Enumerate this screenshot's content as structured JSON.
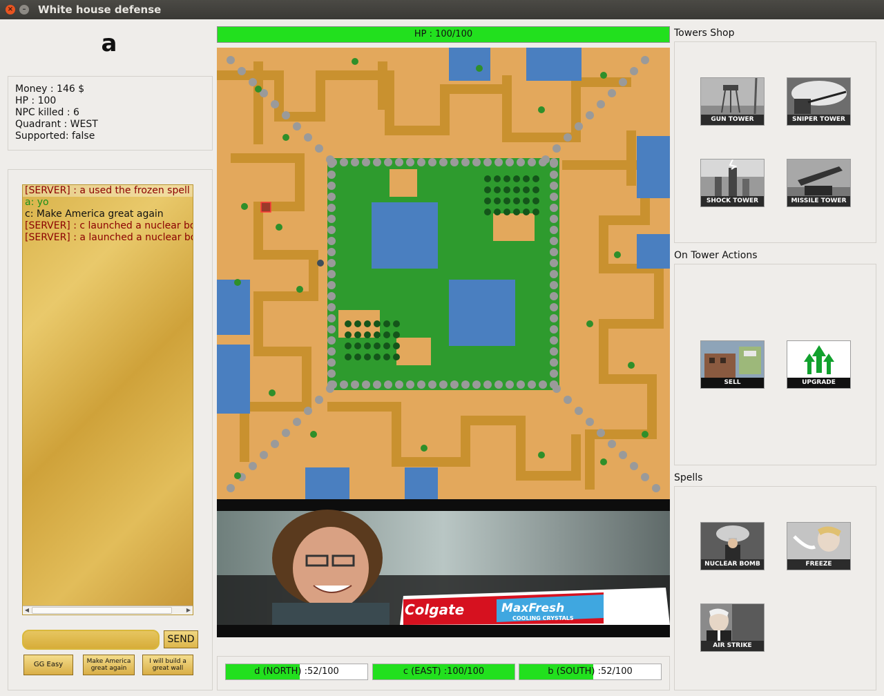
{
  "window": {
    "title": "White house defense"
  },
  "player": {
    "name": "a",
    "money": "Money : 146 $",
    "hp": "HP : 100",
    "npc_killed": "NPC killed : 6",
    "quadrant": "Quadrant : WEST",
    "supported": "Supported: false"
  },
  "chat": {
    "messages": [
      {
        "text": "[SERVER] : a used the frozen spell",
        "kind": "server"
      },
      {
        "text": "a: yo",
        "kind": "player-green"
      },
      {
        "text": "c: Make America great again",
        "kind": "player"
      },
      {
        "text": "[SERVER] : c launched a nuclear bomb",
        "kind": "server"
      },
      {
        "text": "[SERVER] : a launched a nuclear bomb",
        "kind": "server"
      }
    ],
    "input_value": "",
    "send_label": "SEND",
    "quick_messages": [
      "GG Easy",
      "Make America great again",
      "I will build a great wall"
    ]
  },
  "base": {
    "hp_label": "HP : 100/100",
    "hp_fraction": 1.0
  },
  "map": {
    "palette": {
      "sand": "#e3a85c",
      "dirt": "#c9912f",
      "grass": "#2e9b2e",
      "water": "#4a7fc0",
      "rock": "#9a9a9a"
    }
  },
  "ad": {
    "brand": "Colgate",
    "product": "MaxFresh",
    "tagline": "COOLING CRYSTALS"
  },
  "quadrants": [
    {
      "label": "d (NORTH) :52/100",
      "fraction": 0.52
    },
    {
      "label": "c (EAST) :100/100",
      "fraction": 1.0
    },
    {
      "label": "b (SOUTH) :52/100",
      "fraction": 0.52
    }
  ],
  "towers_shop": {
    "title": "Towers Shop",
    "items": [
      {
        "label": "GUN TOWER",
        "icon": "gun-tower-icon"
      },
      {
        "label": "SNIPER TOWER",
        "icon": "sniper-tower-icon"
      },
      {
        "label": "SHOCK TOWER",
        "icon": "shock-tower-icon"
      },
      {
        "label": "MISSILE TOWER",
        "icon": "missile-tower-icon"
      }
    ]
  },
  "tower_actions": {
    "title": "On Tower Actions",
    "items": [
      {
        "label": "SELL",
        "icon": "sell-icon"
      },
      {
        "label": "UPGRADE",
        "icon": "upgrade-icon"
      }
    ]
  },
  "spells": {
    "title": "Spells",
    "items": [
      {
        "label": "NUCLEAR BOMB",
        "icon": "nuclear-bomb-icon"
      },
      {
        "label": "FREEZE",
        "icon": "freeze-icon"
      },
      {
        "label": "AIR STRIKE",
        "icon": "air-strike-icon"
      }
    ]
  },
  "colors": {
    "hp_green": "#22e01e",
    "chat_gold": "#d9b24a",
    "server_text": "#8b0000"
  }
}
